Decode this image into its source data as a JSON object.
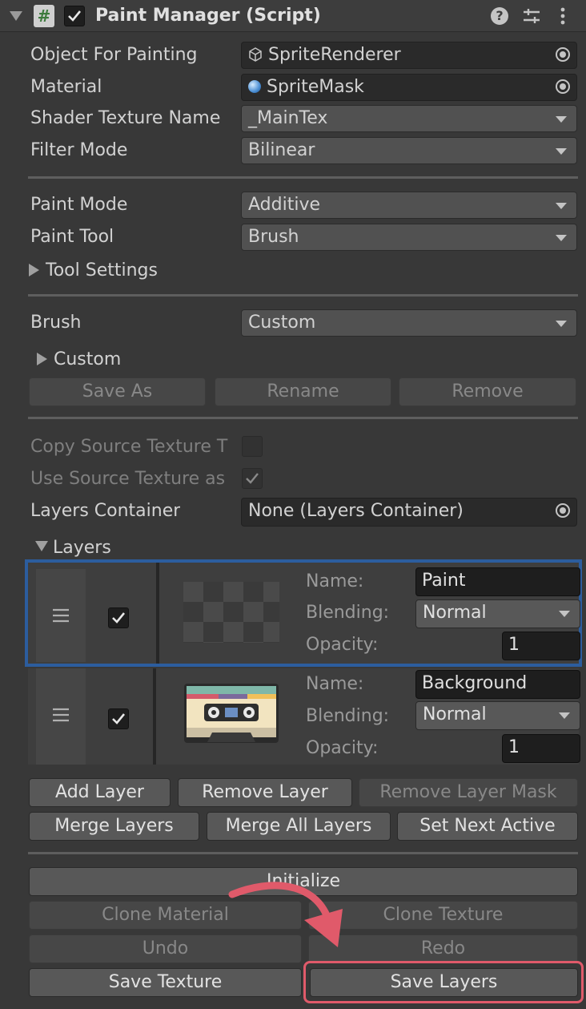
{
  "header": {
    "title": "Paint Manager (Script)",
    "enabled": true,
    "script_icon_glyph": "#"
  },
  "fields": {
    "object_for_painting": {
      "label": "Object For Painting",
      "value": "SpriteRenderer"
    },
    "material": {
      "label": "Material",
      "value": "SpriteMask"
    },
    "shader_texture_name": {
      "label": "Shader Texture Name",
      "value": "_MainTex"
    },
    "filter_mode": {
      "label": "Filter Mode",
      "value": "Bilinear"
    },
    "paint_mode": {
      "label": "Paint Mode",
      "value": "Additive"
    },
    "paint_tool": {
      "label": "Paint Tool",
      "value": "Brush"
    },
    "tool_settings": {
      "label": "Tool Settings"
    },
    "brush": {
      "label": "Brush",
      "value": "Custom"
    },
    "custom_foldout": {
      "label": "Custom"
    },
    "copy_source_texture": {
      "label": "Copy Source Texture T",
      "checked": false
    },
    "use_source_texture": {
      "label": "Use Source Texture as",
      "checked": true
    },
    "layers_container": {
      "label": "Layers Container",
      "value": "None (Layers Container)"
    },
    "layers_foldout": {
      "label": "Layers"
    }
  },
  "brush_buttons": {
    "save_as": "Save As",
    "rename": "Rename",
    "remove": "Remove"
  },
  "layers": [
    {
      "name_label": "Name:",
      "name": "Paint",
      "blending_label": "Blending:",
      "blending": "Normal",
      "opacity_label": "Opacity:",
      "opacity": "1",
      "visible": true,
      "selected": true,
      "thumbnail": "checkerboard-transparent"
    },
    {
      "name_label": "Name:",
      "name": "Background",
      "blending_label": "Blending:",
      "blending": "Normal",
      "opacity_label": "Opacity:",
      "opacity": "1",
      "visible": true,
      "selected": false,
      "thumbnail": "cassette-tape"
    }
  ],
  "layer_buttons": {
    "add_layer": "Add Layer",
    "remove_layer": "Remove Layer",
    "remove_layer_mask": "Remove Layer Mask",
    "merge_layers": "Merge Layers",
    "merge_all_layers": "Merge All Layers",
    "set_next_active": "Set Next Active"
  },
  "actions": {
    "initialize": "Initialize",
    "clone_material": "Clone Material",
    "clone_texture": "Clone Texture",
    "undo": "Undo",
    "redo": "Redo",
    "save_texture": "Save Texture",
    "save_layers": "Save Layers"
  },
  "colors": {
    "panel_bg": "#383838",
    "selection_border": "#2c5d9e",
    "annotation_red": "#e05a6a"
  },
  "icons": [
    "help-icon",
    "settings-icon",
    "more-icon",
    "script-icon",
    "cube-icon",
    "sphere-icon",
    "object-picker-icon",
    "drag-handle-icon"
  ]
}
